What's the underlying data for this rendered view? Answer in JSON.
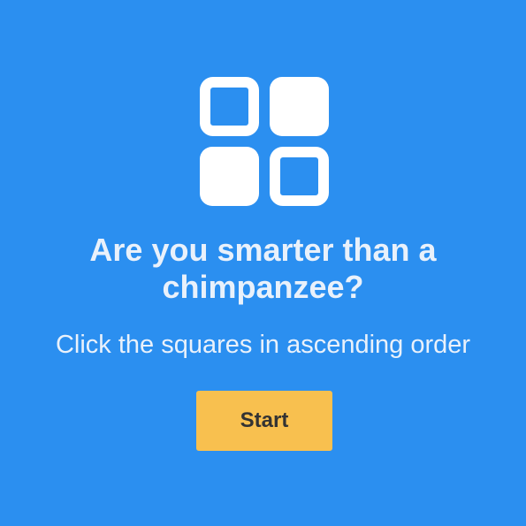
{
  "page": {
    "background_color": "#2b8ff0"
  },
  "logo": {
    "icon": "grid-squares-icon",
    "color": "#ffffff"
  },
  "title": "Are you smarter than a chimpanzee?",
  "subtitle": "Click the squares in ascending order",
  "start_button": {
    "label": "Start",
    "background_color": "#f8c04f",
    "text_color": "#333333"
  }
}
